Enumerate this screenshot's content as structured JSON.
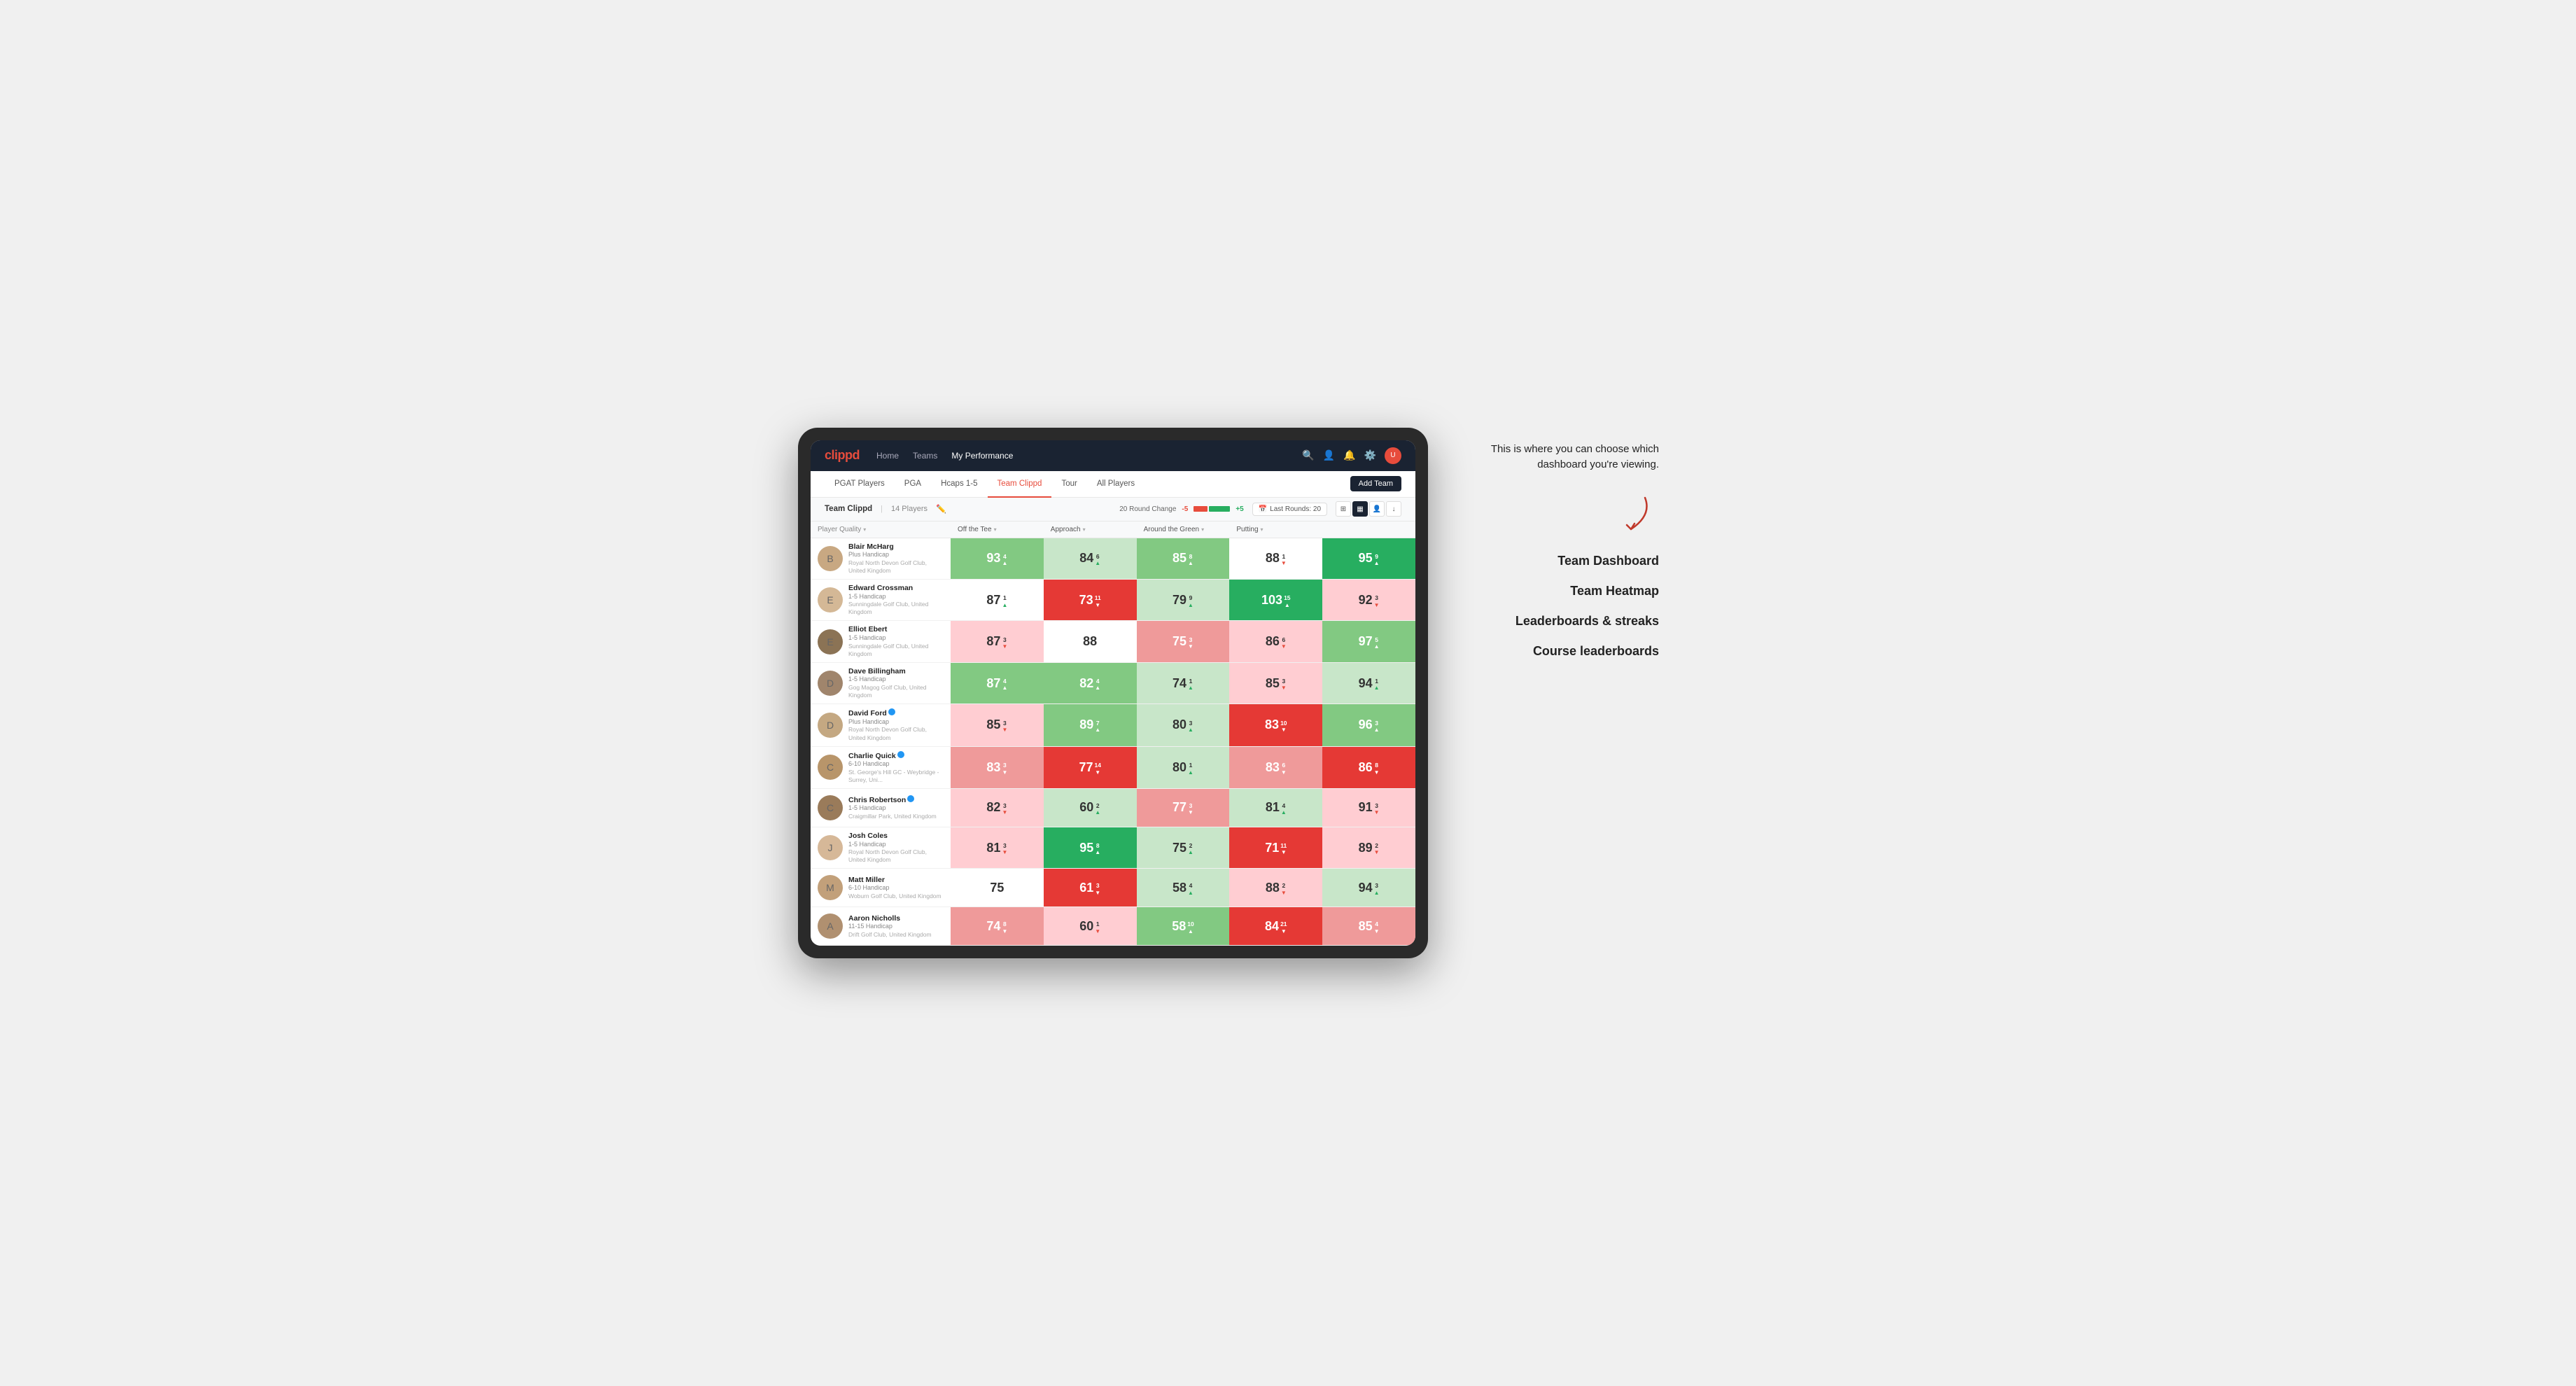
{
  "annotation": {
    "intro_text": "This is where you can choose which dashboard you're viewing.",
    "items": [
      "Team Dashboard",
      "Team Heatmap",
      "Leaderboards & streaks",
      "Course leaderboards"
    ]
  },
  "nav": {
    "logo": "clippd",
    "links": [
      "Home",
      "Teams",
      "My Performance"
    ],
    "active_link": "My Performance"
  },
  "sub_tabs": {
    "tabs": [
      "PGAT Players",
      "PGA",
      "Hcaps 1-5",
      "Team Clippd",
      "Tour",
      "All Players"
    ],
    "active_tab": "Team Clippd",
    "add_button": "Add Team"
  },
  "team_header": {
    "name": "Team Clippd",
    "separator": "|",
    "count": "14 Players",
    "round_change_label": "20 Round Change",
    "change_neg": "-5",
    "change_pos": "+5",
    "last_rounds_icon": "📅",
    "last_rounds_label": "Last Rounds: 20"
  },
  "table": {
    "columns": [
      "Player Quality ▾",
      "Off the Tee ▾",
      "Approach ▾",
      "Around the Green ▾",
      "Putting ▾"
    ],
    "players": [
      {
        "name": "Blair McHarg",
        "handicap": "Plus Handicap",
        "club": "Royal North Devon Golf Club, United Kingdom",
        "stats": [
          {
            "value": 93,
            "change": 4,
            "dir": "up",
            "bg": "green-light"
          },
          {
            "value": 84,
            "change": 6,
            "dir": "up",
            "bg": "green-pale"
          },
          {
            "value": 85,
            "change": 8,
            "dir": "up",
            "bg": "green-light"
          },
          {
            "value": 88,
            "change": 1,
            "dir": "down",
            "bg": "white"
          },
          {
            "value": 95,
            "change": 9,
            "dir": "up",
            "bg": "green-dark"
          }
        ]
      },
      {
        "name": "Edward Crossman",
        "handicap": "1-5 Handicap",
        "club": "Sunningdale Golf Club, United Kingdom",
        "stats": [
          {
            "value": 87,
            "change": 1,
            "dir": "up",
            "bg": "white"
          },
          {
            "value": 73,
            "change": 11,
            "dir": "down",
            "bg": "red-dark"
          },
          {
            "value": 79,
            "change": 9,
            "dir": "up",
            "bg": "green-pale"
          },
          {
            "value": 103,
            "change": 15,
            "dir": "up",
            "bg": "green-dark"
          },
          {
            "value": 92,
            "change": 3,
            "dir": "down",
            "bg": "red-pale"
          }
        ]
      },
      {
        "name": "Elliot Ebert",
        "handicap": "1-5 Handicap",
        "club": "Sunningdale Golf Club, United Kingdom",
        "stats": [
          {
            "value": 87,
            "change": 3,
            "dir": "down",
            "bg": "red-pale"
          },
          {
            "value": 88,
            "change": null,
            "dir": null,
            "bg": "white"
          },
          {
            "value": 75,
            "change": 3,
            "dir": "down",
            "bg": "red-light"
          },
          {
            "value": 86,
            "change": 6,
            "dir": "down",
            "bg": "red-pale"
          },
          {
            "value": 97,
            "change": 5,
            "dir": "up",
            "bg": "green-light"
          }
        ]
      },
      {
        "name": "Dave Billingham",
        "handicap": "1-5 Handicap",
        "club": "Gog Magog Golf Club, United Kingdom",
        "stats": [
          {
            "value": 87,
            "change": 4,
            "dir": "up",
            "bg": "green-light"
          },
          {
            "value": 82,
            "change": 4,
            "dir": "up",
            "bg": "green-light"
          },
          {
            "value": 74,
            "change": 1,
            "dir": "up",
            "bg": "green-pale"
          },
          {
            "value": 85,
            "change": 3,
            "dir": "down",
            "bg": "red-pale"
          },
          {
            "value": 94,
            "change": 1,
            "dir": "up",
            "bg": "green-pale"
          }
        ]
      },
      {
        "name": "David Ford",
        "handicap": "Plus Handicap",
        "club": "Royal North Devon Golf Club, United Kingdom",
        "verified": true,
        "stats": [
          {
            "value": 85,
            "change": 3,
            "dir": "down",
            "bg": "red-pale"
          },
          {
            "value": 89,
            "change": 7,
            "dir": "up",
            "bg": "green-light"
          },
          {
            "value": 80,
            "change": 3,
            "dir": "up",
            "bg": "green-pale"
          },
          {
            "value": 83,
            "change": 10,
            "dir": "down",
            "bg": "red-dark"
          },
          {
            "value": 96,
            "change": 3,
            "dir": "up",
            "bg": "green-light"
          }
        ]
      },
      {
        "name": "Charlie Quick",
        "handicap": "6-10 Handicap",
        "club": "St. George's Hill GC - Weybridge - Surrey, Uni...",
        "verified": true,
        "stats": [
          {
            "value": 83,
            "change": 3,
            "dir": "down",
            "bg": "red-light"
          },
          {
            "value": 77,
            "change": 14,
            "dir": "down",
            "bg": "red-dark"
          },
          {
            "value": 80,
            "change": 1,
            "dir": "up",
            "bg": "green-pale"
          },
          {
            "value": 83,
            "change": 6,
            "dir": "down",
            "bg": "red-light"
          },
          {
            "value": 86,
            "change": 8,
            "dir": "down",
            "bg": "red-dark"
          }
        ]
      },
      {
        "name": "Chris Robertson",
        "handicap": "1-5 Handicap",
        "club": "Craigmillar Park, United Kingdom",
        "verified": true,
        "stats": [
          {
            "value": 82,
            "change": 3,
            "dir": "down",
            "bg": "red-pale"
          },
          {
            "value": 60,
            "change": 2,
            "dir": "up",
            "bg": "green-pale"
          },
          {
            "value": 77,
            "change": 3,
            "dir": "down",
            "bg": "red-light"
          },
          {
            "value": 81,
            "change": 4,
            "dir": "up",
            "bg": "green-pale"
          },
          {
            "value": 91,
            "change": 3,
            "dir": "down",
            "bg": "red-pale"
          }
        ]
      },
      {
        "name": "Josh Coles",
        "handicap": "1-5 Handicap",
        "club": "Royal North Devon Golf Club, United Kingdom",
        "stats": [
          {
            "value": 81,
            "change": 3,
            "dir": "down",
            "bg": "red-pale"
          },
          {
            "value": 95,
            "change": 8,
            "dir": "up",
            "bg": "green-dark"
          },
          {
            "value": 75,
            "change": 2,
            "dir": "up",
            "bg": "green-pale"
          },
          {
            "value": 71,
            "change": 11,
            "dir": "down",
            "bg": "red-dark"
          },
          {
            "value": 89,
            "change": 2,
            "dir": "down",
            "bg": "red-pale"
          }
        ]
      },
      {
        "name": "Matt Miller",
        "handicap": "6-10 Handicap",
        "club": "Woburn Golf Club, United Kingdom",
        "stats": [
          {
            "value": 75,
            "change": null,
            "dir": null,
            "bg": "white"
          },
          {
            "value": 61,
            "change": 3,
            "dir": "down",
            "bg": "red-dark"
          },
          {
            "value": 58,
            "change": 4,
            "dir": "up",
            "bg": "green-pale"
          },
          {
            "value": 88,
            "change": 2,
            "dir": "down",
            "bg": "red-pale"
          },
          {
            "value": 94,
            "change": 3,
            "dir": "up",
            "bg": "green-pale"
          }
        ]
      },
      {
        "name": "Aaron Nicholls",
        "handicap": "11-15 Handicap",
        "club": "Drift Golf Club, United Kingdom",
        "stats": [
          {
            "value": 74,
            "change": 8,
            "dir": "down",
            "bg": "red-light"
          },
          {
            "value": 60,
            "change": 1,
            "dir": "down",
            "bg": "red-pale"
          },
          {
            "value": 58,
            "change": 10,
            "dir": "up",
            "bg": "green-light"
          },
          {
            "value": 84,
            "change": 21,
            "dir": "down",
            "bg": "red-dark"
          },
          {
            "value": 85,
            "change": 4,
            "dir": "down",
            "bg": "red-light"
          }
        ]
      }
    ]
  }
}
